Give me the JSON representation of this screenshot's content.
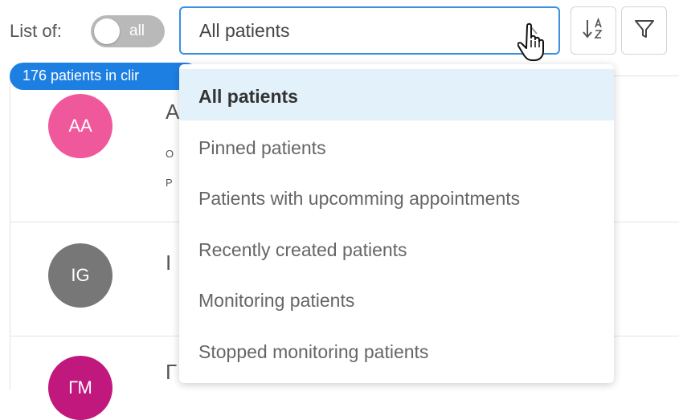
{
  "header": {
    "list_of_label": "List of:",
    "toggle_label": "all",
    "select_value": "All patients",
    "sort_icon": "sort-alpha-icon",
    "filter_icon": "filter-icon"
  },
  "count_badge": "176 patients in clir",
  "patients": [
    {
      "initials": "AA",
      "color": "#f0589c",
      "name_fragment": "A",
      "line1": "O",
      "line2": "P"
    },
    {
      "initials": "IG",
      "color": "#777777",
      "name_fragment": "I",
      "line1": "",
      "line2": ""
    },
    {
      "initials": "ГМ",
      "color": "#c0187d",
      "name_fragment": "Г",
      "line1": "",
      "line2": ""
    }
  ],
  "dropdown": {
    "options": [
      {
        "label": "All patients",
        "selected": true
      },
      {
        "label": "Pinned patients",
        "selected": false
      },
      {
        "label": "Patients with upcomming appointments",
        "selected": false
      },
      {
        "label": "Recently created patients",
        "selected": false
      },
      {
        "label": "Monitoring patients",
        "selected": false
      },
      {
        "label": "Stopped monitoring patients",
        "selected": false
      }
    ]
  },
  "colors": {
    "accent": "#1e7fe3",
    "select_border": "#3d8fe0",
    "selected_bg": "#e3f1fb"
  }
}
